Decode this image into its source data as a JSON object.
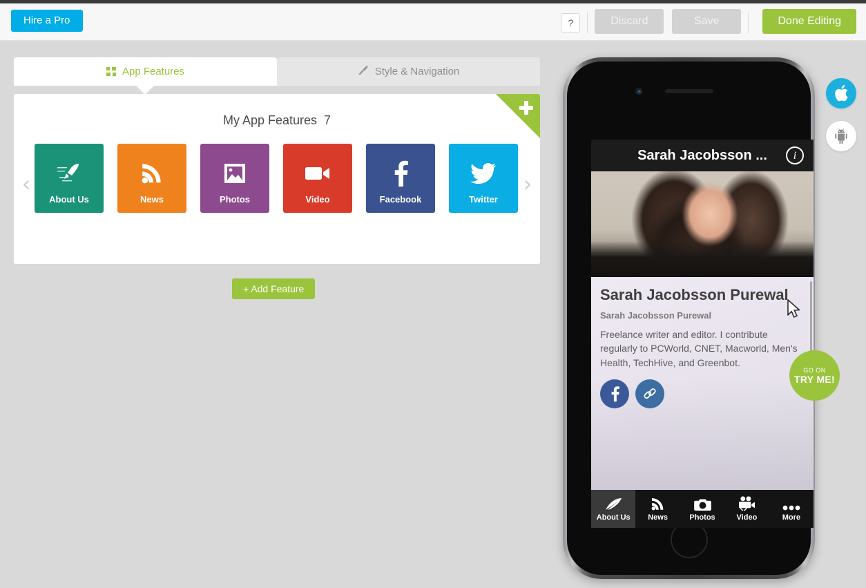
{
  "header": {
    "hire_label": "Hire a Pro",
    "help_label": "?",
    "discard_label": "Discard",
    "save_label": "Save",
    "done_label": "Done Editing",
    "accent_green": "#9ac43c",
    "accent_blue": "#00ade6"
  },
  "tabs": [
    {
      "label": "App Features",
      "icon": "grid-icon",
      "active": true
    },
    {
      "label": "Style & Navigation",
      "icon": "paintbrush-icon",
      "active": false
    }
  ],
  "features_panel": {
    "title": "My App Features",
    "count": "7",
    "prev_arrow": "‹",
    "next_arrow": "›",
    "add_corner_icon": "plus-icon",
    "tiles": [
      {
        "label": "About Us",
        "icon": "quill-pen-icon",
        "color": "#1a9379"
      },
      {
        "label": "News",
        "icon": "rss-icon",
        "color": "#f0821e"
      },
      {
        "label": "Photos",
        "icon": "photo-icon",
        "color": "#8e4a8e"
      },
      {
        "label": "Video",
        "icon": "video-camera-icon",
        "color": "#d93b2b"
      },
      {
        "label": "Facebook",
        "icon": "facebook-icon",
        "color": "#3a5390"
      },
      {
        "label": "Twitter",
        "icon": "twitter-icon",
        "color": "#0aade4"
      }
    ]
  },
  "add_feature_button": "+ Add Feature",
  "preview": {
    "nav_title": "Sarah Jacobsson ...",
    "info_icon": "info-icon",
    "profile": {
      "name": "Sarah Jacobsson Purewal",
      "subtitle": "Sarah Jacobsson Purewal",
      "bio": "Freelance writer and editor. I contribute regularly to PCWorld, CNET, Macworld, Men's Health, TechHive, and Greenbot."
    },
    "social": [
      {
        "name": "facebook-icon"
      },
      {
        "name": "link-chain-icon"
      }
    ],
    "tabbar": [
      {
        "label": "About Us",
        "icon": "feather-icon",
        "active": true
      },
      {
        "label": "News",
        "icon": "rss-icon",
        "active": false
      },
      {
        "label": "Photos",
        "icon": "camera-icon",
        "active": false
      },
      {
        "label": "Video",
        "icon": "movie-camera-icon",
        "active": false
      },
      {
        "label": "More",
        "icon": "ellipsis-icon",
        "active": false
      }
    ]
  },
  "try_badge": {
    "line1": "GO ON",
    "line2": "TRY ME!"
  },
  "platforms": [
    {
      "name": "apple-icon",
      "active": true
    },
    {
      "name": "android-icon",
      "active": false
    }
  ]
}
